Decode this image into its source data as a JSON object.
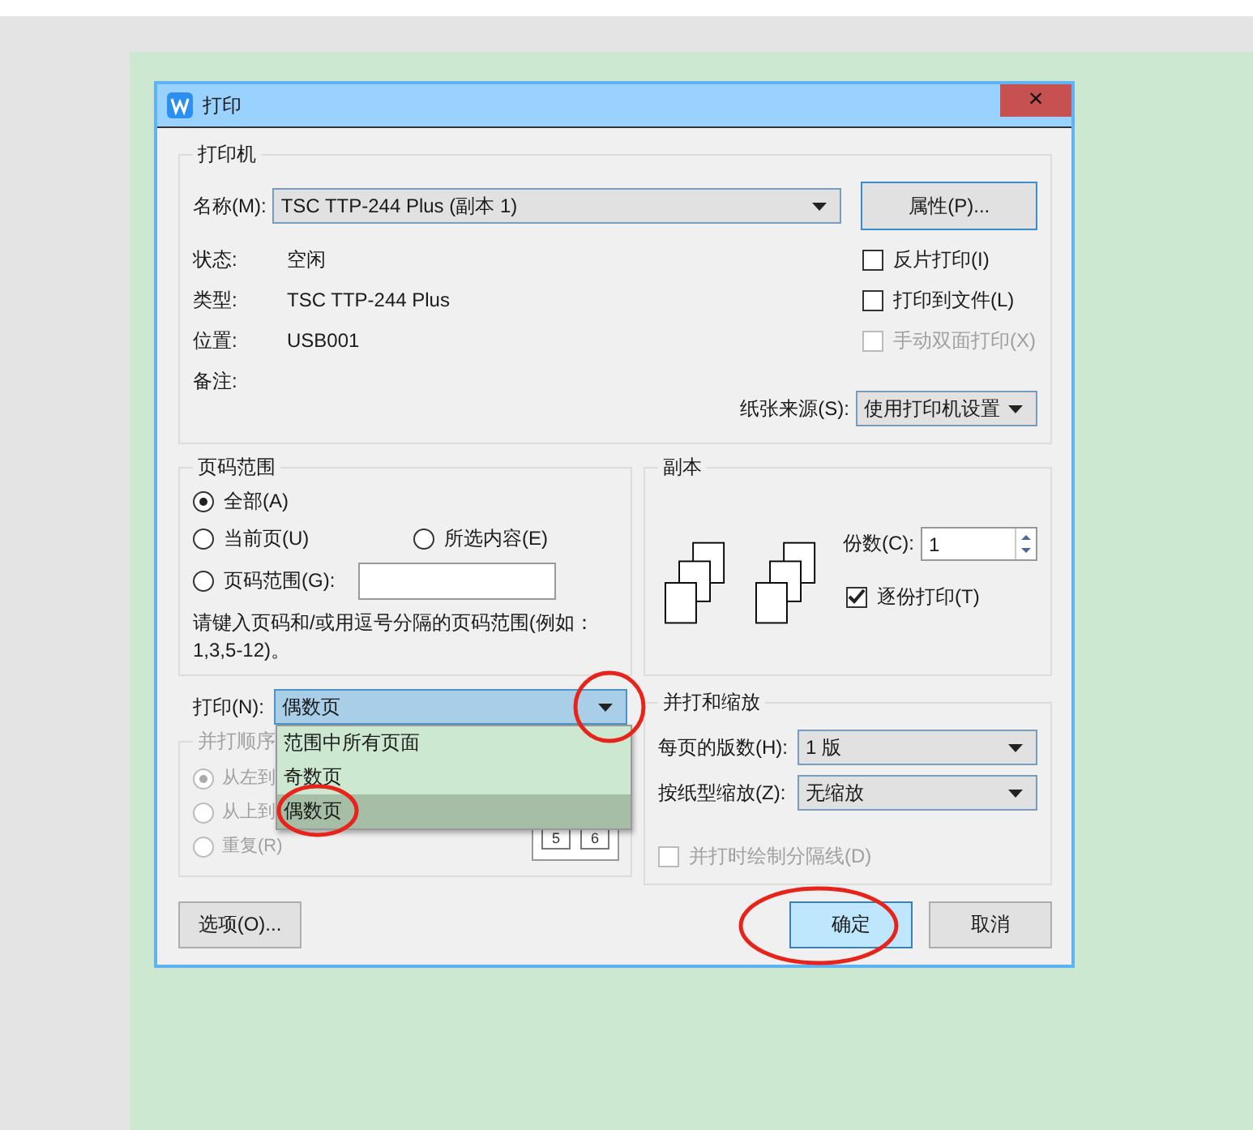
{
  "window": {
    "title": "打印",
    "close": "×"
  },
  "printer": {
    "legend": "打印机",
    "name_label": "名称(M):",
    "name_value": "TSC TTP-244 Plus (副本 1)",
    "properties_button": "属性(P)...",
    "info": [
      {
        "label": "状态:",
        "value": "空闲"
      },
      {
        "label": "类型:",
        "value": "TSC TTP-244 Plus"
      },
      {
        "label": "位置:",
        "value": "USB001"
      },
      {
        "label": "备注:"
      }
    ],
    "options": [
      {
        "label": "反片打印(I)",
        "checked": false,
        "disabled": false
      },
      {
        "label": "打印到文件(L)",
        "checked": false,
        "disabled": false
      },
      {
        "label": "手动双面打印(X)",
        "checked": false,
        "disabled": true
      }
    ],
    "paper_source_label": "纸张来源(S):",
    "paper_source_value": "使用打印机设置"
  },
  "page_range": {
    "legend": "页码范围",
    "options": [
      {
        "label": "全部(A)",
        "selected": true
      },
      {
        "label": "当前页(U)",
        "selected": false
      },
      {
        "label": "所选内容(E)",
        "selected": false
      },
      {
        "label": "页码范围(G):",
        "selected": false
      }
    ],
    "hint": "请键入页码和/或用逗号分隔的页码范围(例如：1,3,5-12)。"
  },
  "copies": {
    "legend": "副本",
    "count_label": "份数(C):",
    "count_value": "1",
    "collate_label": "逐份打印(T)",
    "collate_checked": true
  },
  "print": {
    "label": "打印(N):",
    "value": "偶数页",
    "expanded": true,
    "options": [
      {
        "label": "范围中所有页面",
        "selected": false
      },
      {
        "label": "奇数页",
        "selected": false
      },
      {
        "label": "偶数页",
        "selected": true
      }
    ]
  },
  "order": {
    "legend": "并打顺序",
    "disabled": true,
    "options": [
      {
        "label": "从左到",
        "selected": true
      },
      {
        "label": "从上到",
        "selected": false
      },
      {
        "label": "重复(R)",
        "selected": false
      }
    ],
    "preview_pages": [
      "5",
      "6"
    ]
  },
  "scale": {
    "legend": "并打和缩放",
    "pages_per_sheet_label": "每页的版数(H):",
    "pages_per_sheet_value": "1 版",
    "scale_label": "按纸型缩放(Z):",
    "scale_value": "无缩放",
    "draw_borders_label": "并打时绘制分隔线(D)",
    "draw_borders_checked": false,
    "draw_borders_disabled": true
  },
  "buttons": [
    {
      "label": "选项(O)...",
      "kind": "options",
      "focused": false
    },
    {
      "label": "确定",
      "kind": "ok",
      "focused": true
    },
    {
      "label": "取消",
      "kind": "cancel",
      "focused": false
    }
  ]
}
